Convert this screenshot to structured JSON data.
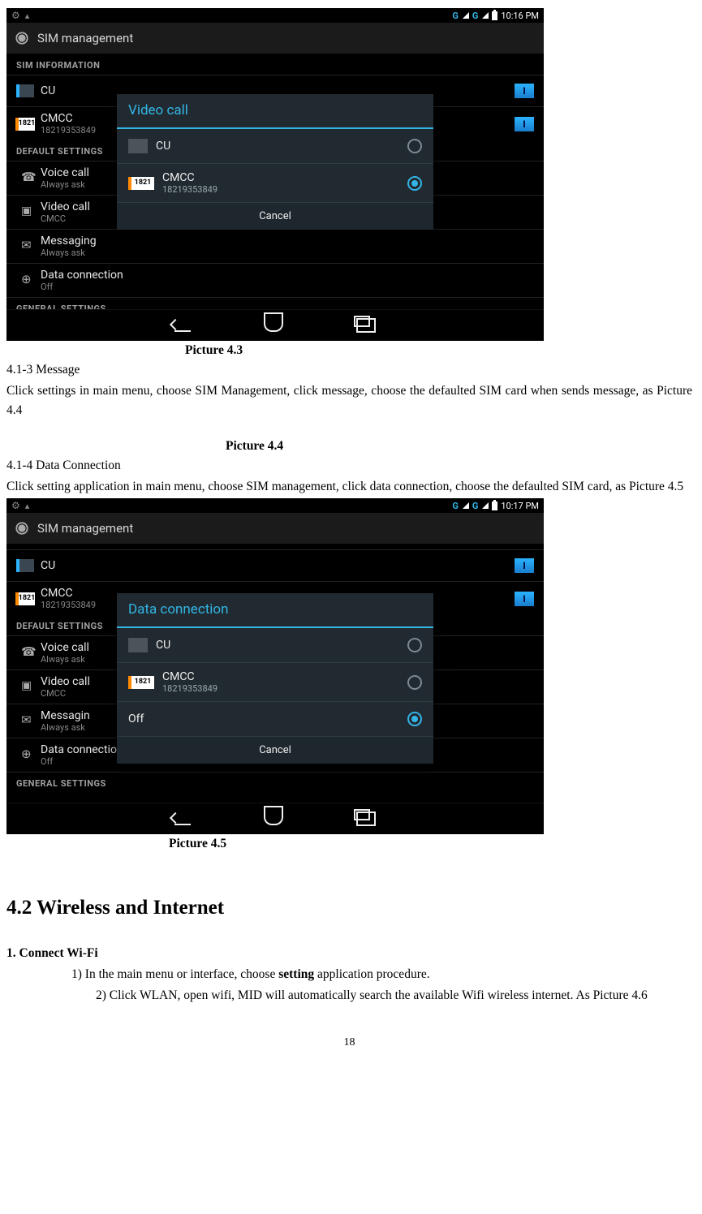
{
  "screenshot43": {
    "status_time": "10:16 PM",
    "status_g": "G",
    "action_title": "SIM management",
    "sections": {
      "sim_info": "SIM INFORMATION",
      "default": "DEFAULT SETTINGS",
      "general": "GENERAL SETTINGS"
    },
    "sim1": {
      "badge": "",
      "name": "CU",
      "chip": "I"
    },
    "sim2": {
      "badge": "1821",
      "name": "CMCC",
      "sub": "18219353849",
      "chip": "I"
    },
    "voice": {
      "title": "Voice call",
      "sub": "Always ask"
    },
    "video": {
      "title": "Video call",
      "sub": "CMCC"
    },
    "msg": {
      "title": "Messaging",
      "sub": "Always ask"
    },
    "data": {
      "title": "Data connection",
      "sub": "Off"
    },
    "dialog": {
      "title": "Video call",
      "opt1": {
        "name": "CU"
      },
      "opt2": {
        "badge": "1821",
        "name": "CMCC",
        "sub": "18219353849"
      },
      "cancel": "Cancel"
    }
  },
  "caption43": "Picture 4.3",
  "text_413_title": "4.1-3 Message",
  "text_413_body": "Click settings in main menu, choose SIM Management, click message, choose the defaulted SIM card when sends message, as Picture 4.4",
  "caption44": "Picture 4.4",
  "text_414_title": "4.1-4 Data Connection",
  "text_414_body": "Click setting application in main menu, choose SIM management, click data connection, choose the defaulted SIM card, as Picture 4.5",
  "screenshot45": {
    "status_time": "10:17 PM",
    "status_g": "G",
    "action_title": "SIM management",
    "sections": {
      "default": "DEFAULT SETTINGS",
      "general": "GENERAL SETTINGS"
    },
    "sim1": {
      "name": "CU",
      "chip": "I"
    },
    "sim2": {
      "badge": "1821",
      "name": "CMCC",
      "sub": "18219353849",
      "chip": "I"
    },
    "voice": {
      "title": "Voice call",
      "sub": "Always ask"
    },
    "video": {
      "title": "Video call",
      "sub": "CMCC"
    },
    "msg": {
      "title": "Messagin",
      "sub": "Always ask"
    },
    "data": {
      "title": "Data connection",
      "sub": "Off"
    },
    "dialog": {
      "title": "Data connection",
      "opt1": {
        "name": "CU"
      },
      "opt2": {
        "badge": "1821",
        "name": "CMCC",
        "sub": "18219353849"
      },
      "opt3": {
        "name": "Off"
      },
      "cancel": "Cancel"
    }
  },
  "caption45": "Picture 4.5",
  "heading_42": "4.2 Wireless and Internet",
  "wifi_heading": "1. Connect Wi-Fi",
  "wifi_step1_pre": "1) In the main menu or interface, choose ",
  "wifi_step1_bold": "setting",
  "wifi_step1_post": " application procedure.",
  "wifi_step2": "2) Click WLAN, open wifi, MID will automatically search the available Wifi wireless internet. As Picture 4.6",
  "page_number": "18"
}
